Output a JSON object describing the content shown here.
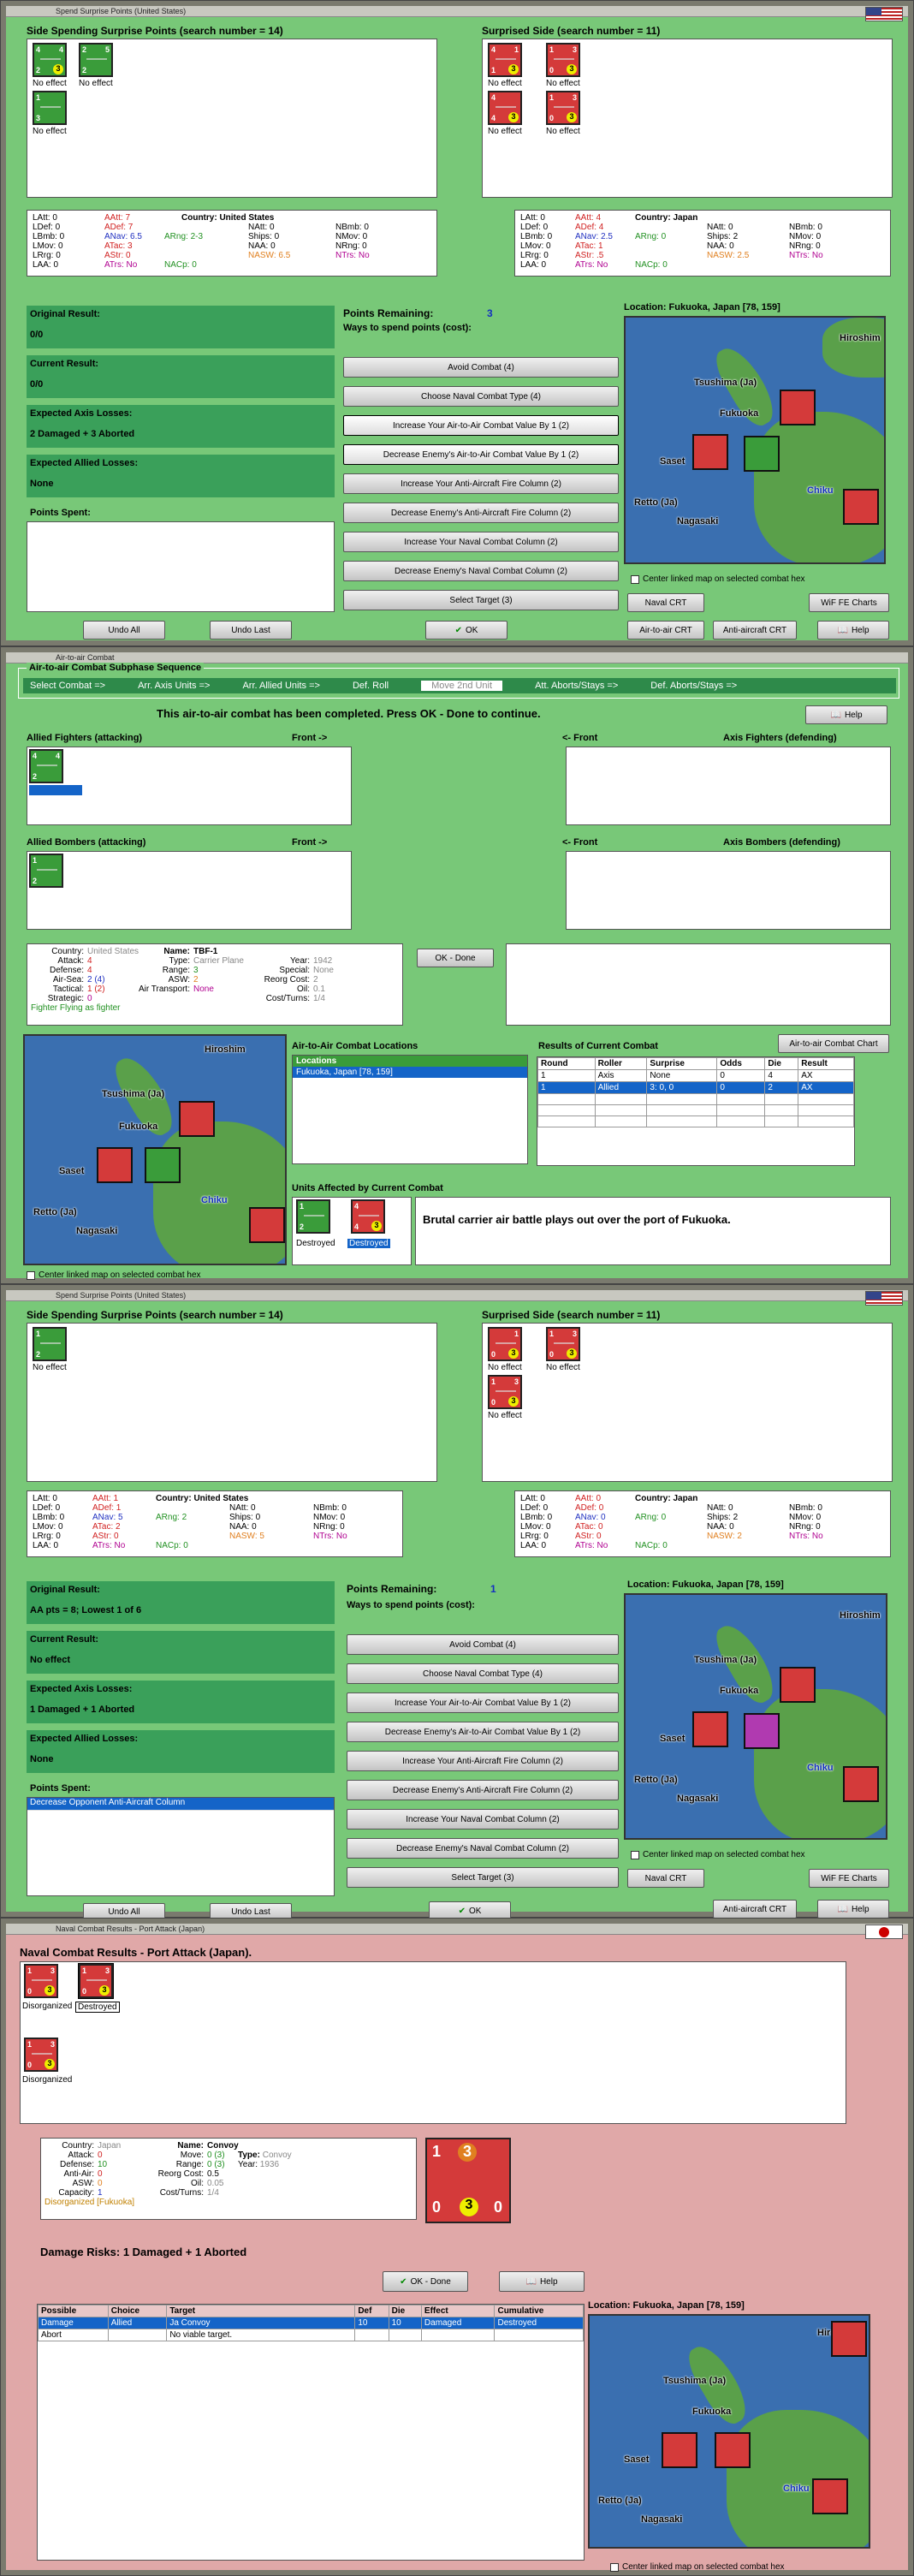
{
  "w1": {
    "title": "Spend Surprise Points (United States)",
    "left_head": "Side Spending Surprise Points (search number = 14)",
    "right_head": "Surprised Side (search number = 11)",
    "left_units": [
      {
        "a": "4",
        "b": "4",
        "c": "2",
        "d": "3",
        "cap": "No effect",
        "col": "g"
      },
      {
        "a": "2",
        "b": "5",
        "c": "2",
        "d": "",
        "cap": "No effect",
        "col": "g"
      },
      {
        "a": "1",
        "b": "",
        "c": "3",
        "d": "",
        "cap": "No effect",
        "col": "g"
      }
    ],
    "right_units": [
      {
        "a": "4",
        "b": "1",
        "c": "1",
        "d": "3",
        "cap": "No effect",
        "col": "r"
      },
      {
        "a": "1",
        "b": "3",
        "c": "0",
        "d": "3",
        "cap": "No effect",
        "col": "r"
      },
      {
        "a": "4",
        "b": "",
        "c": "4",
        "d": "3",
        "cap": "No effect",
        "col": "r"
      },
      {
        "a": "1",
        "b": "3",
        "c": "0",
        "d": "3",
        "cap": "No effect",
        "col": "r"
      }
    ],
    "us_stats": {
      "c1": [
        "LAtt: 0",
        "LDef: 0",
        "LBmb: 0",
        "LMov: 0",
        "LRrg: 0",
        "LAA: 0"
      ],
      "c2": [
        "AAtt: 7",
        "ADef: 7",
        "ANav: 6.5",
        "ATac: 3",
        "AStr: 0",
        "ATrs: No"
      ],
      "c3": [
        "ARng: 2-3",
        "NACp: 0"
      ],
      "c4": [
        "NAtt: 0",
        "Ships: 0",
        "NAA: 0",
        "NASW: 6.5"
      ],
      "c5": [
        "NBmb: 0",
        "NMov: 0",
        "NRng: 0",
        "NTrs: No"
      ],
      "country_label": "Country:",
      "country": "United States"
    },
    "jp_stats": {
      "c1": [
        "LAtt: 0",
        "LDef: 0",
        "LBmb: 0",
        "LMov: 0",
        "LRrg: 0",
        "LAA: 0"
      ],
      "c2": [
        "AAtt: 4",
        "ADef: 4",
        "ANav: 2.5",
        "ATac: 1",
        "AStr: .5",
        "ATrs: No"
      ],
      "c3": [
        "ARng: 0",
        "NACp: 0"
      ],
      "c4": [
        "NAtt: 0",
        "Ships: 2",
        "NAA: 0",
        "NASW: 2.5"
      ],
      "c5": [
        "NBmb: 0",
        "NMov: 0",
        "NRng: 0",
        "NTrs: No"
      ],
      "country_label": "Country:",
      "country": "Japan"
    },
    "orig_label": "Original Result:",
    "orig_val": "0/0",
    "cur_label": "Current Result:",
    "cur_val": "0/0",
    "axis_label": "Expected Axis Losses:",
    "axis_val": "2 Damaged + 3 Aborted",
    "allied_label": "Expected Allied Losses:",
    "allied_val": "None",
    "spent_label": "Points Spent:",
    "spent_items": [],
    "pts_label": "Points Remaining:",
    "pts_val": "3",
    "ways": "Ways to spend points (cost):",
    "options": [
      "Avoid Combat (4)",
      "Choose Naval Combat Type (4)",
      "Increase Your Air-to-Air Combat Value By 1 (2)",
      "Decrease Enemy's Air-to-Air Combat Value By 1 (2)",
      "Increase Your Anti-Aircraft Fire Column (2)",
      "Decrease Enemy's Anti-Aircraft Fire Column (2)",
      "Increase Your Naval Combat Column (2)",
      "Decrease Enemy's Naval Combat Column (2)",
      "Select Target (3)"
    ],
    "location": "Location: Fukuoka, Japan [78, 159]",
    "center": "Center linked map on selected combat hex",
    "undo_all": "Undo All",
    "undo_last": "Undo Last",
    "ok": "OK",
    "naval_crt": "Naval CRT",
    "wif": "WiF FE Charts",
    "air_crt": "Air-to-air CRT",
    "aa_crt": "Anti-aircraft CRT",
    "help": "Help"
  },
  "map": {
    "hiroshima": "Hiroshim",
    "tsushima": "Tsushima (Ja)",
    "fukuoka": "Fukuoka",
    "saset": "Saset",
    "retto": "Retto (Ja)",
    "nagasaki": "Nagasaki",
    "chiku": "Chiku"
  },
  "w2": {
    "title": "Air-to-air Combat",
    "seq_title": "Air-to-air Combat Subphase Sequence",
    "tabs": [
      "Select Combat =>",
      "Arr. Axis Units =>",
      "Arr. Allied Units =>",
      "Def. Roll",
      "Move 2nd Unit",
      "Att. Aborts/Stays =>",
      "Def. Aborts/Stays =>"
    ],
    "msg": "This air-to-air combat has been completed.  Press OK - Done to continue.",
    "help": "Help",
    "af": "Allied Fighters (attacking)",
    "front1": "Front ->",
    "front2": "<- Front",
    "xf": "Axis Fighters (defending)",
    "ab": "Allied Bombers (attacking)",
    "xb": "Axis Bombers (defending)",
    "info": {
      "country_l": "Country:",
      "country": "United States",
      "attack_l": "Attack:",
      "attack": "4",
      "defense_l": "Defense:",
      "defense": "4",
      "airsea_l": "Air-Sea:",
      "airsea": "2 (4)",
      "tactical_l": "Tactical:",
      "tactical": "1 (2)",
      "strategic_l": "Strategic:",
      "strategic": "0",
      "fighter": "Fighter Flying as fighter",
      "name_l": "Name:",
      "name": "TBF-1",
      "type_l": "Type:",
      "type": "Carrier Plane",
      "range_l": "Range:",
      "range": "3",
      "asw_l": "ASW:",
      "asw": "2",
      "airt_l": "Air Transport:",
      "airt": "None",
      "year_l": "Year:",
      "year": "1942",
      "special_l": "Special:",
      "special": "None",
      "reorg_l": "Reorg Cost:",
      "reorg": "2",
      "oil_l": "Oil:",
      "oil": "0.1",
      "ct_l": "Cost/Turns:",
      "ct": "1/4"
    },
    "okdone": "OK - Done",
    "locs_head": "Air-to-Air Combat Locations",
    "locs_col": "Locations",
    "locs": [
      "Fukuoka, Japan [78, 159]"
    ],
    "results_head": "Results of Current Combat",
    "chart": "Air-to-air Combat Chart",
    "res_cols": [
      "Round",
      "Roller",
      "Surprise",
      "Odds",
      "Die",
      "Result"
    ],
    "res_rows": [
      [
        "1",
        "Axis",
        "None",
        "0",
        "4",
        "AX"
      ],
      [
        "1",
        "Allied",
        "3: 0, 0",
        "0",
        "2",
        "AX"
      ]
    ],
    "affected": "Units Affected by Current Combat",
    "aff_caps": [
      "Destroyed",
      "Destroyed"
    ],
    "story": "Brutal carrier air battle plays out over the port of Fukuoka.",
    "center": "Center linked map on selected combat hex"
  },
  "w3": {
    "title": "Spend Surprise Points (United States)",
    "left_head": "Side Spending Surprise Points (search number = 14)",
    "right_head": "Surprised Side (search number = 11)",
    "left_units": [
      {
        "a": "1",
        "b": "",
        "c": "2",
        "d": "",
        "cap": "No effect",
        "col": "g"
      }
    ],
    "right_units": [
      {
        "a": "",
        "b": "1",
        "c": "0",
        "d": "3",
        "cap": "No effect",
        "col": "r"
      },
      {
        "a": "1",
        "b": "3",
        "c": "0",
        "d": "3",
        "cap": "No effect",
        "col": "r"
      },
      {
        "a": "1",
        "b": "3",
        "c": "0",
        "d": "3",
        "cap": "No effect",
        "col": "r"
      }
    ],
    "us_stats": {
      "c1": [
        "LAtt: 0",
        "LDef: 0",
        "LBmb: 0",
        "LMov: 0",
        "LRrg: 0",
        "LAA: 0"
      ],
      "c2": [
        "AAtt: 1",
        "ADef: 1",
        "ANav: 5",
        "ATac: 2",
        "AStr: 0",
        "ATrs: No"
      ],
      "c3": [
        "ARng: 2",
        "NACp: 0"
      ],
      "c4": [
        "NAtt: 0",
        "Ships: 0",
        "NAA: 0",
        "NASW: 5"
      ],
      "c5": [
        "NBmb: 0",
        "NMov: 0",
        "NRng: 0",
        "NTrs: No"
      ],
      "country_label": "Country:",
      "country": "United States"
    },
    "jp_stats": {
      "c1": [
        "LAtt: 0",
        "LDef: 0",
        "LBmb: 0",
        "LMov: 0",
        "LRrg: 0",
        "LAA: 0"
      ],
      "c2": [
        "AAtt: 0",
        "ADef: 0",
        "ANav: 0",
        "ATac: 0",
        "AStr: 0",
        "ATrs: No"
      ],
      "c3": [
        "ARng: 0",
        "NACp: 0"
      ],
      "c4": [
        "NAtt: 0",
        "Ships: 2",
        "NAA: 0",
        "NASW: 2"
      ],
      "c5": [
        "NBmb: 0",
        "NMov: 0",
        "NRng: 0",
        "NTrs: No"
      ],
      "country_label": "Country:",
      "country": "Japan"
    },
    "orig_label": "Original Result:",
    "orig_val": "AA pts = 8; Lowest 1 of 6",
    "cur_label": "Current Result:",
    "cur_val": "No effect",
    "axis_label": "Expected Axis Losses:",
    "axis_val": "1 Damaged + 1 Aborted",
    "allied_label": "Expected Allied Losses:",
    "allied_val": "None",
    "spent_label": "Points Spent:",
    "spent_items": [
      "Decrease Opponent Anti-Aircraft Column"
    ],
    "pts_label": "Points Remaining:",
    "pts_val": "1",
    "ways": "Ways to spend points (cost):",
    "options": [
      "Avoid Combat (4)",
      "Choose Naval Combat Type (4)",
      "Increase Your Air-to-Air Combat Value By 1 (2)",
      "Decrease Enemy's Air-to-Air Combat Value By 1 (2)",
      "Increase Your Anti-Aircraft Fire Column (2)",
      "Decrease Enemy's Anti-Aircraft Fire Column (2)",
      "Increase Your Naval Combat Column (2)",
      "Decrease Enemy's Naval Combat Column (2)",
      "Select Target (3)"
    ],
    "location": "Location: Fukuoka, Japan [78, 159]",
    "center": "Center linked map on selected combat hex",
    "undo_all": "Undo All",
    "undo_last": "Undo Last",
    "ok": "OK",
    "naval_crt": "Naval CRT",
    "wif": "WiF FE Charts",
    "aa_crt": "Anti-aircraft CRT",
    "help": "Help"
  },
  "w4": {
    "title": "Naval Combat Results - Port Attack (Japan)",
    "head": "Naval Combat Results - Port Attack (Japan).",
    "units": [
      {
        "cap": "Disorganized"
      },
      {
        "cap": "Destroyed"
      },
      {
        "cap": "Disorganized"
      }
    ],
    "info": {
      "country_l": "Country:",
      "country": "Japan",
      "attack_l": "Attack:",
      "attack": "0",
      "defense_l": "Defense:",
      "defense": "10",
      "aa_l": "Anti-Air:",
      "aa": "0",
      "asw_l": "ASW:",
      "asw": "0",
      "cap_l": "Capacity:",
      "capv": "1",
      "disorg": "Disorganized [Fukuoka]",
      "name_l": "Name:",
      "name": "Convoy",
      "move_l": "Move:",
      "move": "0 (3)",
      "range_l": "Range:",
      "range": "0 (3)",
      "reorg_l": "Reorg Cost:",
      "reorg": "0.5",
      "oil_l": "Oil:",
      "oil": "0.05",
      "ct_l": "Cost/Turns:",
      "ct": "1/4",
      "type_l": "Type:",
      "type": "Convoy",
      "year_l": "Year:",
      "year": "1936"
    },
    "big": {
      "a": "1",
      "b": "3",
      "c": "0",
      "d": "3",
      "e": "0"
    },
    "risks": "Damage Risks: 1 Damaged + 1 Aborted",
    "okdone": "OK - Done",
    "help": "Help",
    "cols": [
      "Possible",
      "Choice",
      "Target",
      "Def",
      "Die",
      "Effect",
      "Cumulative"
    ],
    "rows": [
      [
        "Damage",
        "Allied",
        "Ja Convoy",
        "10",
        "10",
        "Damaged",
        "Destroyed"
      ],
      [
        "Abort",
        "",
        "No viable target.",
        "",
        "",
        "",
        ""
      ]
    ],
    "location": "Location: Fukuoka, Japan [78, 159]",
    "center": "Center linked map on selected combat hex"
  }
}
